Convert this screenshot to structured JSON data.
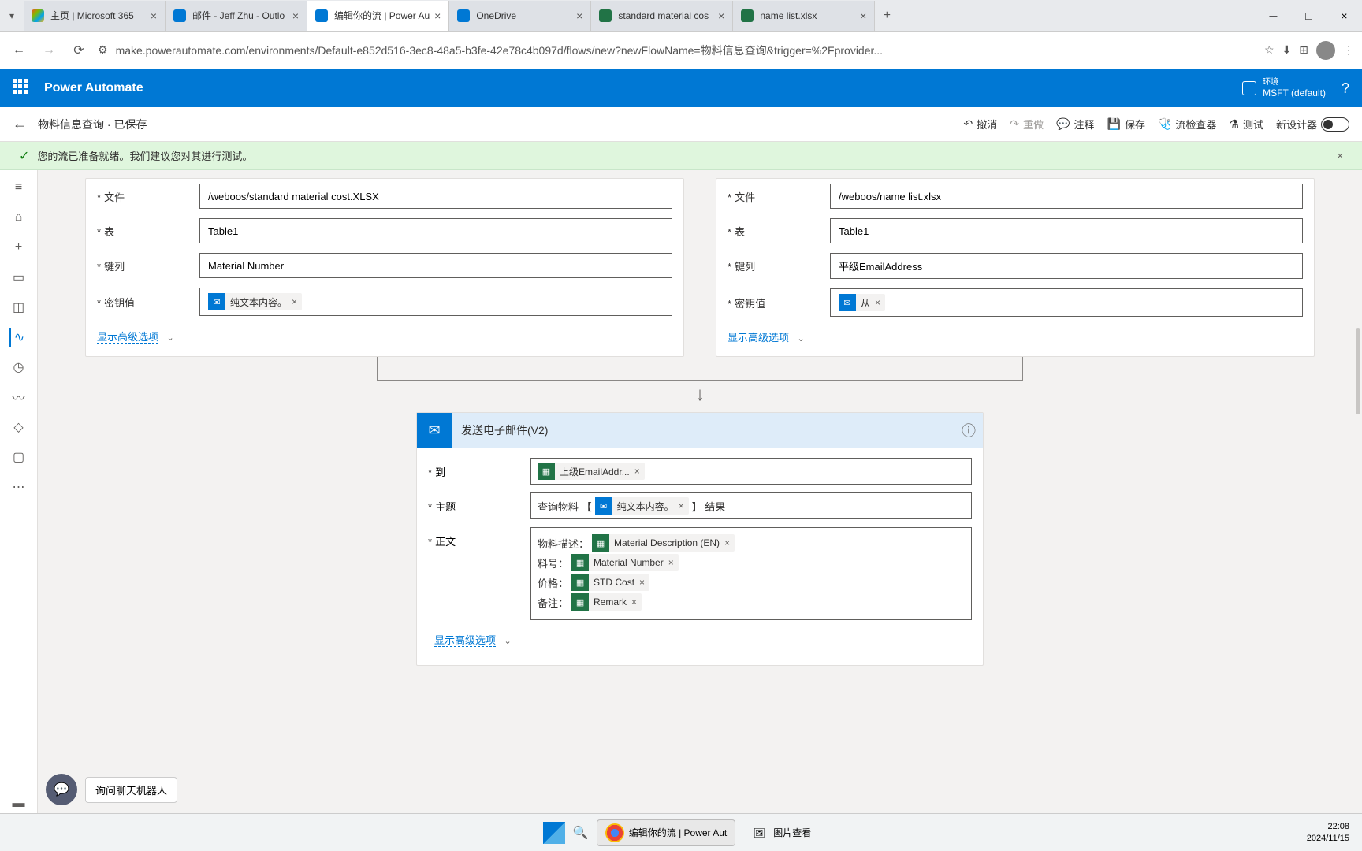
{
  "browser": {
    "tabs": [
      {
        "title": "主页 | Microsoft 365",
        "icon_color": "#0078d4"
      },
      {
        "title": "邮件 - Jeff Zhu - Outlo",
        "icon_color": "#0078d4"
      },
      {
        "title": "编辑你的流 | Power Au",
        "icon_color": "#0078d4",
        "active": true
      },
      {
        "title": "OneDrive",
        "icon_color": "#0078d4"
      },
      {
        "title": "standard material cos",
        "icon_color": "#217346"
      },
      {
        "title": "name list.xlsx",
        "icon_color": "#217346"
      }
    ],
    "url": "make.powerautomate.com/environments/Default-e852d516-3ec8-48a5-b3fe-42e78c4b097d/flows/new?newFlowName=物料信息查询&trigger=%2Fprovider..."
  },
  "pa_header": {
    "title": "Power Automate",
    "env_label": "环境",
    "env_name": "MSFT (default)"
  },
  "toolbar": {
    "back": "←",
    "title": "物料信息查询 · 已保存",
    "undo": "撤消",
    "redo": "重做",
    "comment": "注释",
    "save": "保存",
    "checker": "流检查器",
    "test": "测试",
    "new_designer": "新设计器"
  },
  "notification": {
    "text": "您的流已准备就绪。我们建议您对其进行测试。"
  },
  "left_card": {
    "file_label": "文件",
    "file_value": "/weboos/standard material cost.XLSX",
    "table_label": "表",
    "table_value": "Table1",
    "key_col_label": "键列",
    "key_col_value": "Material Number",
    "key_val_label": "密钥值",
    "key_val_token": "纯文本内容。",
    "advanced": "显示高级选项"
  },
  "right_card": {
    "file_label": "文件",
    "file_value": "/weboos/name list.xlsx",
    "table_label": "表",
    "table_value": "Table1",
    "key_col_label": "键列",
    "key_col_value": "平级EmailAddress",
    "key_val_label": "密钥值",
    "key_val_token": "从",
    "advanced": "显示高级选项"
  },
  "email_card": {
    "title": "发送电子邮件(V2)",
    "to_label": "到",
    "to_token": "上级EmailAddr...",
    "subject_label": "主题",
    "subject_prefix": "查询物料 【",
    "subject_token": "纯文本内容。",
    "subject_suffix": "】 结果",
    "body_label": "正文",
    "body_line1_prefix": "物料描述：",
    "body_line1_token": "Material Description (EN)",
    "body_line2_prefix": "料号：",
    "body_line2_token": "Material Number",
    "body_line3_prefix": "价格：",
    "body_line3_token": "STD Cost",
    "body_line4_prefix": "备注：",
    "body_line4_token": "Remark",
    "advanced": "显示高级选项"
  },
  "chatbot": {
    "text": "询问聊天机器人"
  },
  "taskbar": {
    "item1": "编辑你的流 | Power Aut",
    "item2": "图片查看",
    "time": "22:08",
    "date": "2024/11/15"
  }
}
